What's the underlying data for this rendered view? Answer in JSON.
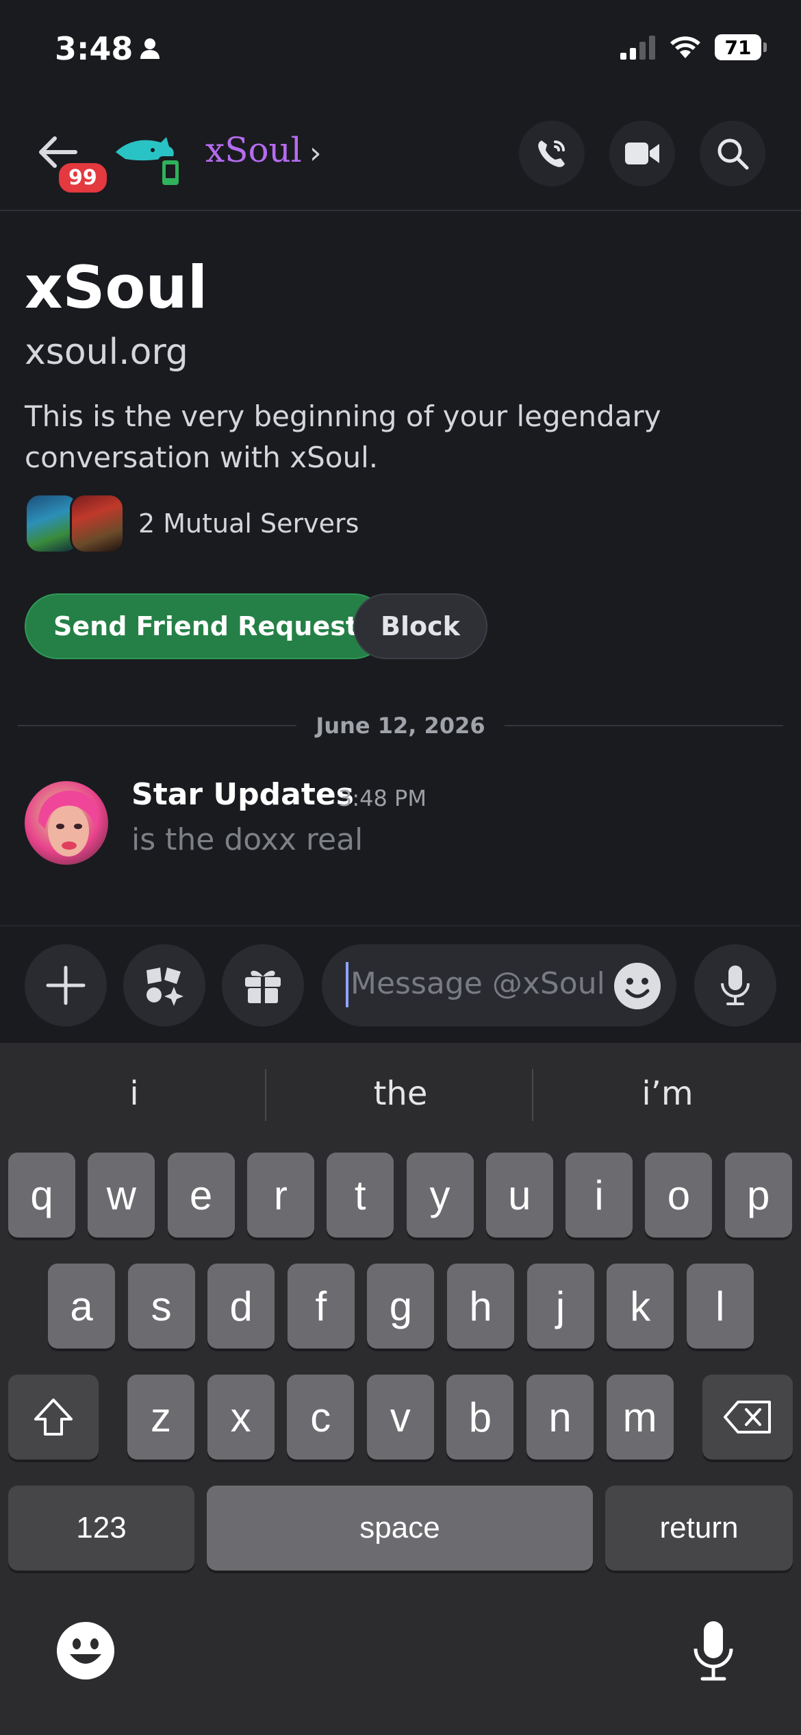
{
  "status": {
    "time": "3:48",
    "battery": "71"
  },
  "header": {
    "unread": "99",
    "name": "xSoul"
  },
  "intro": {
    "title": "xSoul",
    "subtitle": "xsoul.org",
    "description": "This is the very beginning of your legendary conversation with xSoul.",
    "mutual": "2 Mutual Servers",
    "friend_button": "Send Friend Request",
    "block_button": "Block"
  },
  "divider": {
    "date": "June 12, 2026"
  },
  "message": {
    "author": "Star Updates",
    "time": "3:48 PM",
    "text": "is the doxx real"
  },
  "composer": {
    "placeholder": "Message @xSoul"
  },
  "keyboard": {
    "suggestions": [
      "i",
      "the",
      "i’m"
    ],
    "row1": [
      "q",
      "w",
      "e",
      "r",
      "t",
      "y",
      "u",
      "i",
      "o",
      "p"
    ],
    "row2": [
      "a",
      "s",
      "d",
      "f",
      "g",
      "h",
      "j",
      "k",
      "l"
    ],
    "row3": [
      "z",
      "x",
      "c",
      "v",
      "b",
      "n",
      "m"
    ],
    "numbers": "123",
    "space": "space",
    "return": "return"
  },
  "colors": {
    "accent_purple": "#b56cf0",
    "friend_green": "#248046",
    "badge_red": "#e3393f"
  }
}
